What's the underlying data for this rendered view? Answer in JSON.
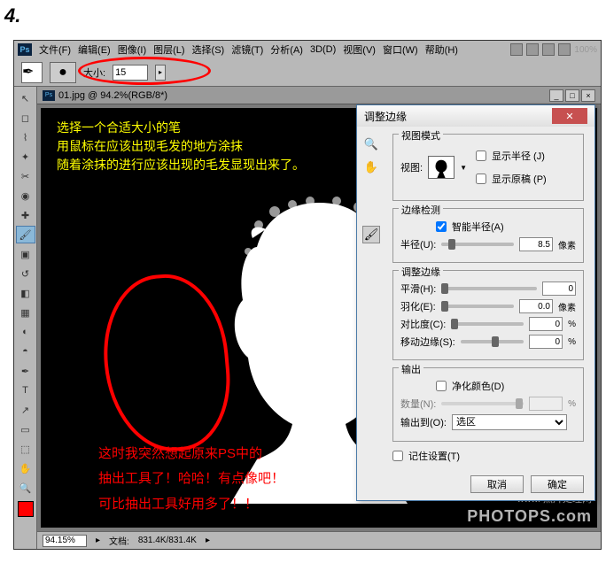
{
  "step": "4.",
  "menubar": {
    "items": [
      "文件(F)",
      "编辑(E)",
      "图像(I)",
      "图层(L)",
      "选择(S)",
      "滤镜(T)",
      "分析(A)",
      "3D(D)",
      "视图(V)",
      "窗口(W)",
      "帮助(H)"
    ],
    "zoom_label": "100%"
  },
  "options": {
    "size_label": "大小:",
    "size_value": "15"
  },
  "document": {
    "title": "01.jpg @ 94.2%(RGB/8*)"
  },
  "canvas": {
    "yellow_lines": [
      "选择一个合适大小的笔",
      "用鼠标在应该出现毛发的地方涂抹",
      "随着涂抹的进行应该出现的毛发显现出来了。"
    ],
    "red_lines": [
      "这时我突然想起原来PS中的",
      "抽出工具了！哈哈！有点像吧！",
      "可比抽出工具好用多了！！"
    ]
  },
  "statusbar": {
    "zoom": "94.15%",
    "doc_label": "文档:",
    "doc_size": "831.4K/831.4K"
  },
  "watermark": {
    "line1": "www.          照片处理网",
    "line2": "PHOTOPS.com"
  },
  "dialog": {
    "title": "调整边缘",
    "g_view": {
      "legend": "视图模式",
      "view_label": "视图:",
      "show_radius": "显示半径 (J)",
      "show_original": "显示原稿 (P)"
    },
    "g_edge": {
      "legend": "边缘检测",
      "smart_radius": "智能半径(A)",
      "radius_label": "半径(U):",
      "radius_value": "8.5",
      "radius_unit": "像素"
    },
    "g_adjust": {
      "legend": "调整边缘",
      "smooth_label": "平滑(H):",
      "smooth_value": "0",
      "feather_label": "羽化(E):",
      "feather_value": "0.0",
      "feather_unit": "像素",
      "contrast_label": "对比度(C):",
      "contrast_value": "0",
      "contrast_unit": "%",
      "shift_label": "移动边缘(S):",
      "shift_value": "0",
      "shift_unit": "%"
    },
    "g_output": {
      "legend": "输出",
      "decon_label": "净化颜色(D)",
      "amount_label": "数量(N):",
      "amount_unit": "%",
      "output_to_label": "输出到(O):",
      "output_to_value": "选区"
    },
    "remember": "记住设置(T)",
    "cancel": "取消",
    "ok": "确定"
  }
}
